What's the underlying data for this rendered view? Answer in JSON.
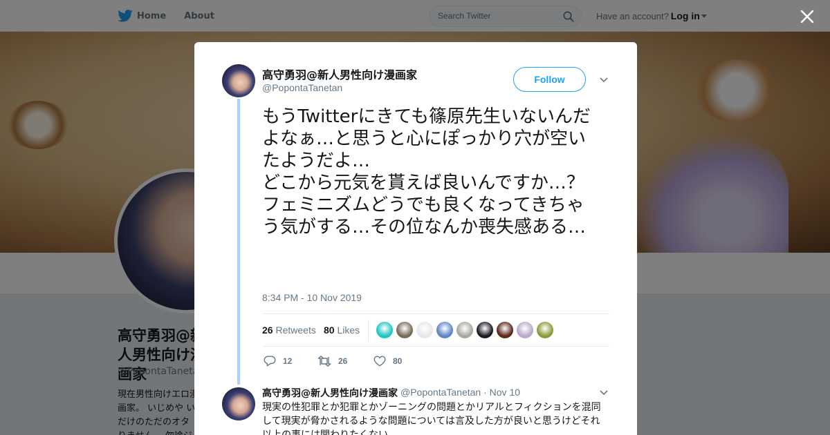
{
  "nav": {
    "home_label": "Home",
    "about_label": "About",
    "search_placeholder": "Search Twitter",
    "account_prompt": "Have an account?",
    "login_label": "Log in"
  },
  "background_profile": {
    "name": "高守勇羽@新人男性向け漫画家",
    "handle": "@PopontaTanetan",
    "bio": "現在男性向けエロ漫画家。 いじめや いだけのただのオタ りません。 勿論ジ"
  },
  "tweet": {
    "author_name": "高守勇羽@新人男性向け漫画家",
    "author_handle": "@PopontaTanetan",
    "follow_label": "Follow",
    "text": "もうTwitterにきても篠原先生いないんだよなぁ…と思うと心にぽっかり穴が空いたようだよ…\nどこから元気を貰えば良いんですか…？\nフェミニズムどうでも良くなってきちゃう気がする…その位なんか喪失感ある…",
    "timestamp": "8:34 PM - 10 Nov 2019",
    "retweets_count": "26",
    "retweets_label": "Retweets",
    "likes_count": "80",
    "likes_label": "Likes",
    "likers": [
      {
        "color": "#1fc6c4"
      },
      {
        "color": "#7a6a5a"
      },
      {
        "color": "#e8e8e8"
      },
      {
        "color": "#5e86c4"
      },
      {
        "color": "#a8a8a0"
      },
      {
        "color": "#1a1a22"
      },
      {
        "color": "#5a2a1a"
      },
      {
        "color": "#b8aac8"
      },
      {
        "color": "#8a9a3a"
      }
    ],
    "reply_count": "12",
    "retweet_action_count": "26",
    "like_action_count": "80"
  },
  "reply": {
    "author_name": "高守勇羽@新人男性向け漫画家",
    "author_handle": "@PopontaTanetan",
    "separator": "·",
    "date": "Nov 10",
    "text": "現実の性犯罪とか犯罪とかゾーニングの問題とかリアルとフィクションを混同して現実が脅かされるような問題については言及した方が良いと思うけどそれ以上の事には関わりたくない"
  },
  "colors": {
    "brand": "#1da1f2",
    "thread_line": "#a6d4fa",
    "muted_text": "#657786"
  }
}
